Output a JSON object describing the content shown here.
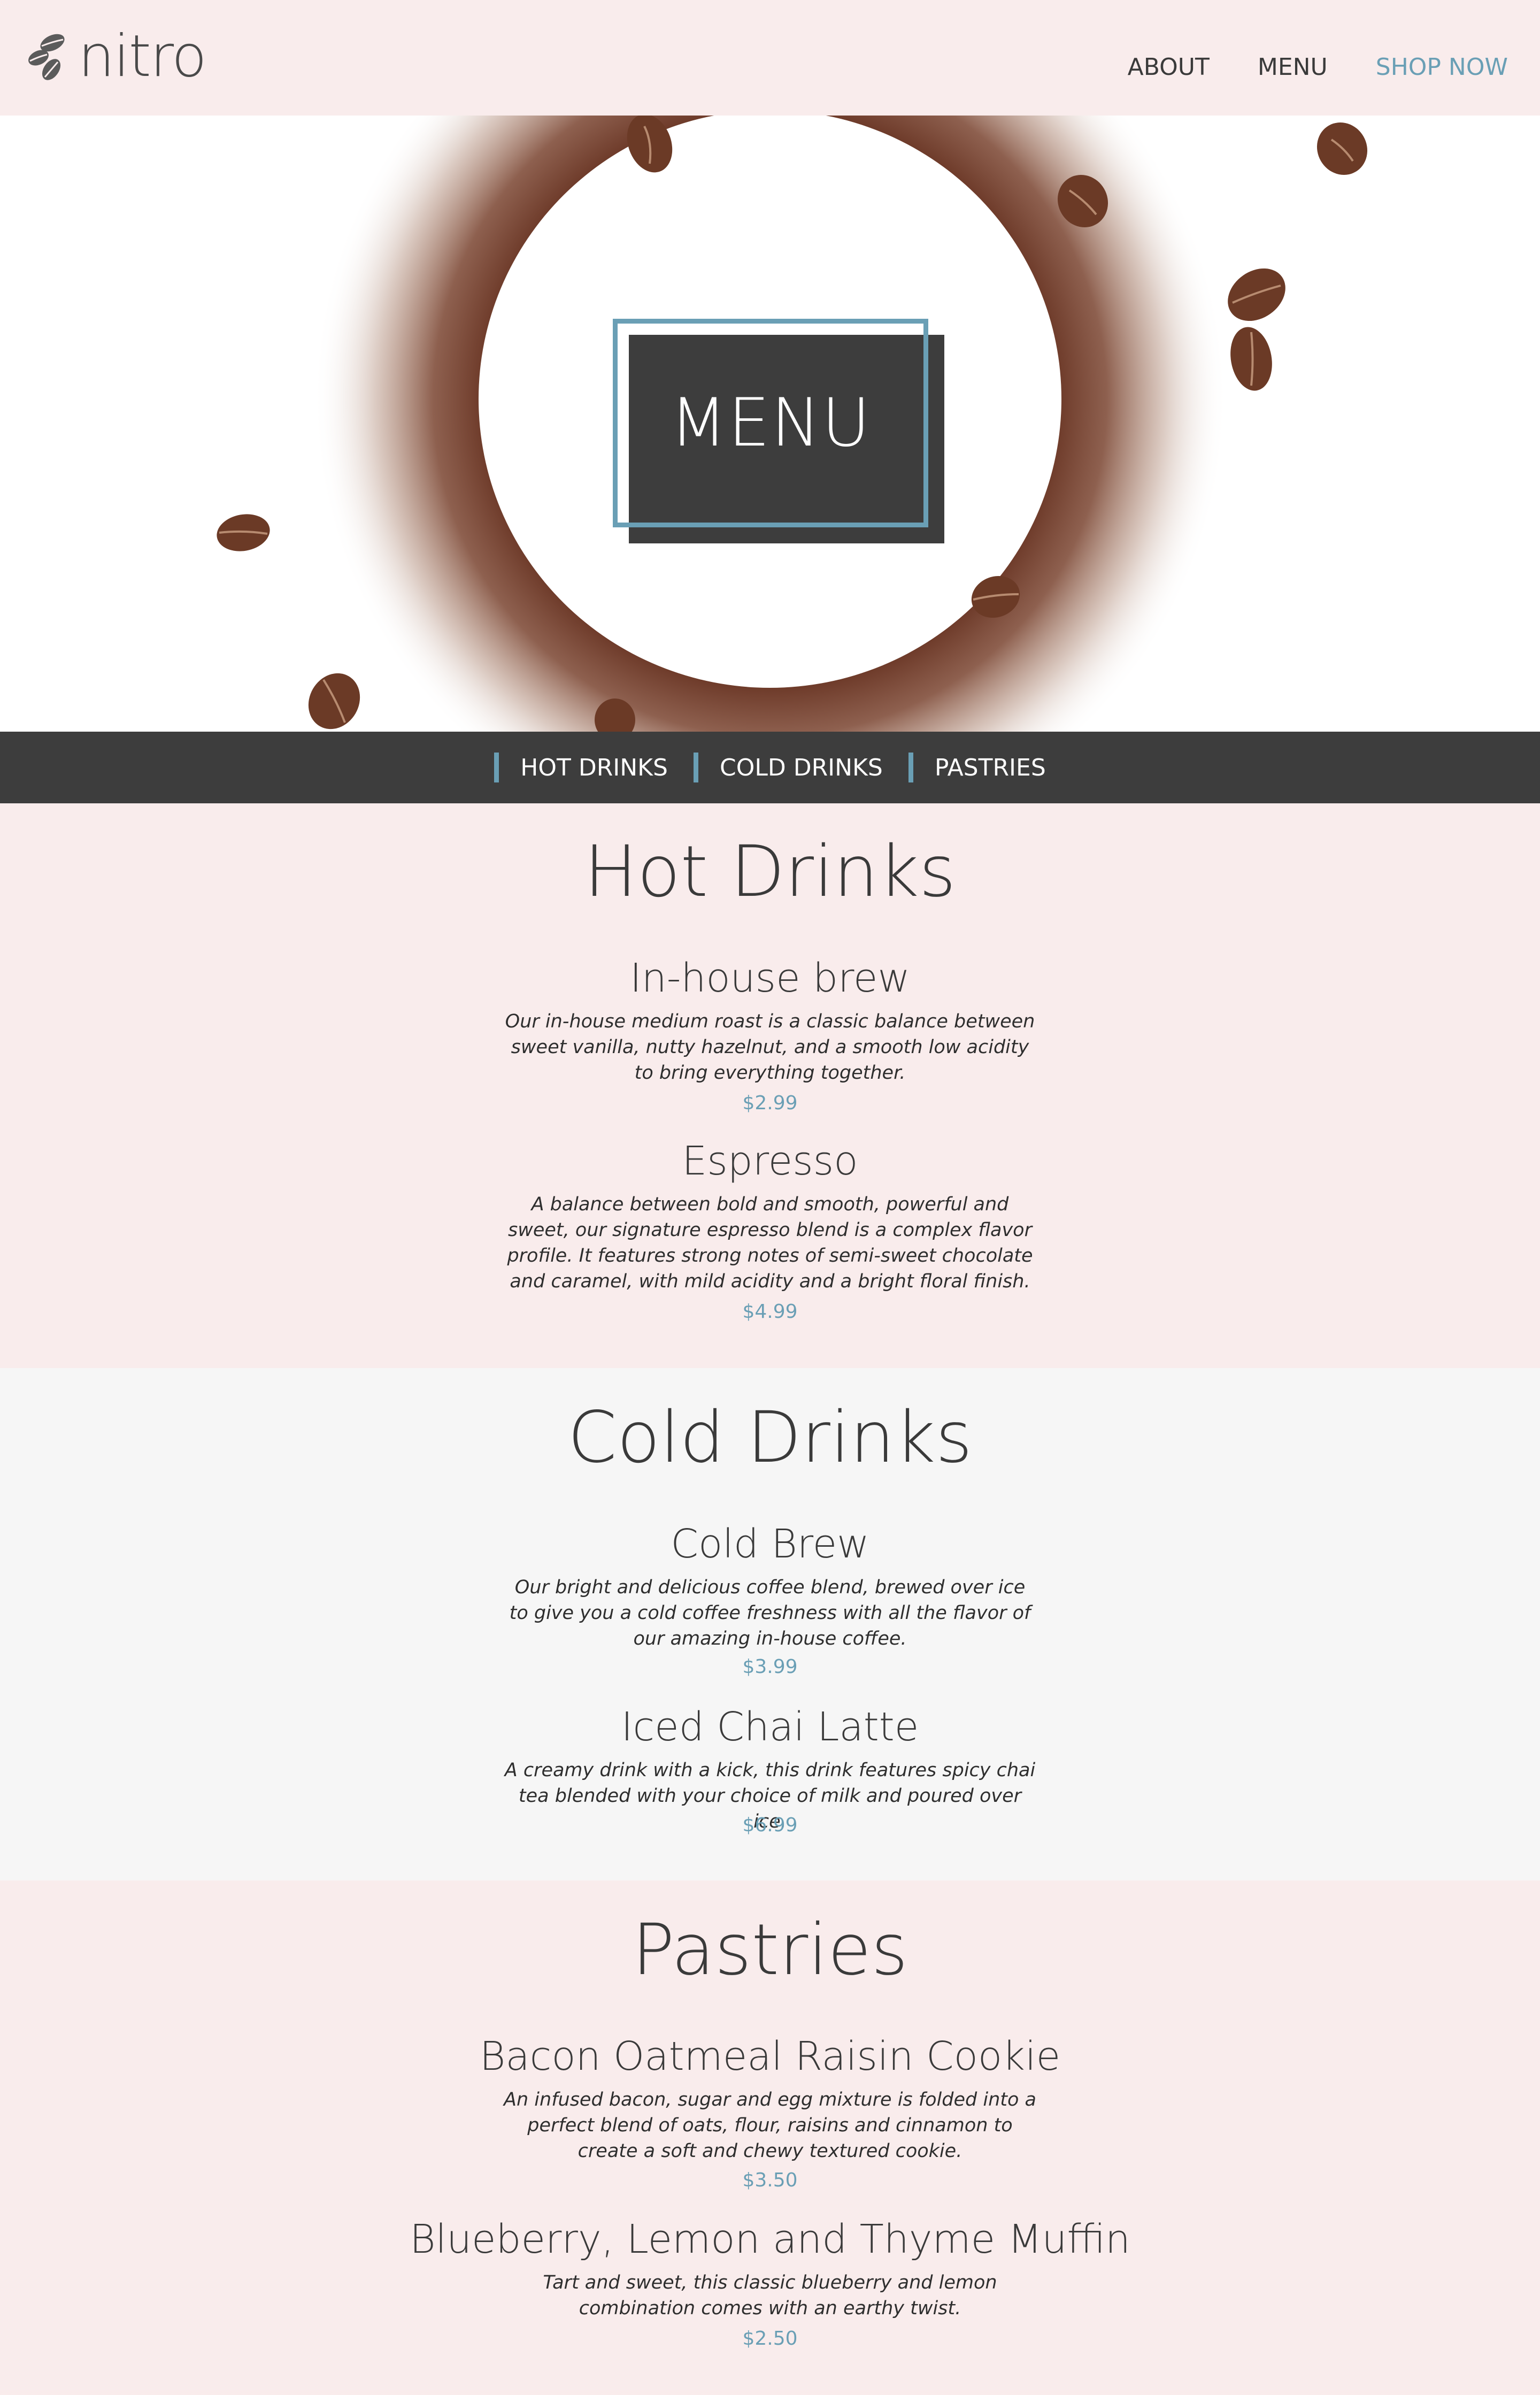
{
  "header": {
    "logo_text": "nitro",
    "nav": [
      {
        "label": "ABOUT"
      },
      {
        "label": "MENU"
      },
      {
        "label": "SHOP NOW"
      }
    ]
  },
  "hero": {
    "title": "MENU"
  },
  "category_nav": [
    {
      "label": "HOT DRINKS"
    },
    {
      "label": "COLD DRINKS"
    },
    {
      "label": "PASTRIES"
    }
  ],
  "sections": [
    {
      "title": "Hot Drinks",
      "items": [
        {
          "name": "In-house brew",
          "description": "Our in-house medium roast is a classic balance between sweet vanilla, nutty hazelnut, and a smooth low acidity to bring everything together.",
          "price": "$2.99"
        },
        {
          "name": "Espresso",
          "description": "A balance between bold and smooth, powerful and sweet, our signature espresso blend is a complex flavor profile. It features strong notes of semi-sweet chocolate and caramel, with mild acidity and a bright floral finish.",
          "price": "$4.99"
        }
      ]
    },
    {
      "title": "Cold Drinks",
      "items": [
        {
          "name": "Cold Brew",
          "description": "Our bright and delicious coffee blend, brewed over ice to give you a cold coffee freshness with all the flavor of our amazing in-house coffee.",
          "price": "$3.99"
        },
        {
          "name": "Iced Chai Latte",
          "description": "A creamy drink with a kick, this drink features spicy chai tea blended with your choice of milk and poured over ice.",
          "price": "$6.99"
        }
      ]
    },
    {
      "title": "Pastries",
      "items": [
        {
          "name": "Bacon Oatmeal Raisin Cookie",
          "description": "An infused bacon, sugar and egg mixture is folded into a perfect blend of oats, flour, raisins and cinnamon to create a soft and chewy textured cookie.",
          "price": "$3.50"
        },
        {
          "name": "Blueberry, Lemon and Thyme Muffin",
          "description": "Tart and sweet, this classic blueberry and lemon combination comes with an earthy twist.",
          "price": "$2.50"
        }
      ]
    }
  ],
  "colors": {
    "accent": "#6a9fb5",
    "dark": "#3d3d3d",
    "pink_bg": "#f9ecec",
    "gray_bg": "#f6f6f6"
  }
}
